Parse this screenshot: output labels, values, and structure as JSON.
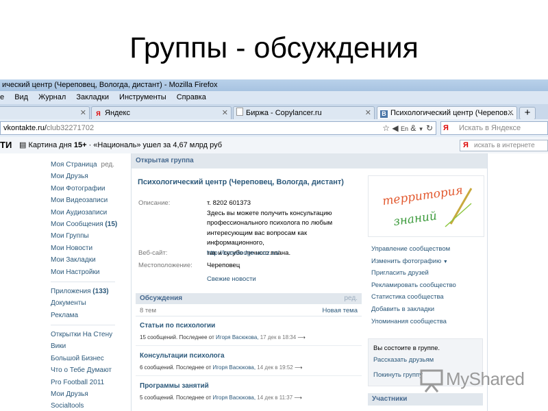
{
  "slide": {
    "title": "Группы - обсуждения"
  },
  "browser": {
    "window_title": "ический центр (Череповец, Вологда, дистант) - Mozilla Firefox",
    "menu": [
      "Вид",
      "Журнал",
      "Закладки",
      "Инструменты",
      "Справка"
    ],
    "menu_first_fragment": "е",
    "tabs": [
      {
        "label": "",
        "icon": "blank-page-icon"
      },
      {
        "label": "Яндекс",
        "icon": "yandex-icon"
      },
      {
        "label": "Биржа - Copylancer.ru",
        "icon": "blank-page-icon"
      },
      {
        "label": "Психологический центр (Черепов...",
        "icon": "vk-icon",
        "active": true
      }
    ],
    "new_tab": "+",
    "url_host": "vkontakte.ru/",
    "url_path": "club32271702",
    "search_placeholder": "Искать в Яндексе",
    "bookmark_logo": "ТИ",
    "news_ticker": "Картина дня 15+ · «Националь» ушел за 4,67 млрд руб",
    "news_day": "Картина дня",
    "news_count": "15+",
    "news_text": "«Националь» ушел за 4,67 млрд руб",
    "yandex_placeholder": "искать в интернете"
  },
  "left_nav": {
    "group1": [
      {
        "label": "Моя Страница",
        "edit": "ред."
      },
      {
        "label": "Мои Друзья"
      },
      {
        "label": "Мои Фотографии"
      },
      {
        "label": "Мои Видеозаписи"
      },
      {
        "label": "Мои Аудиозаписи"
      },
      {
        "label": "Мои Сообщения",
        "count": "(15)"
      },
      {
        "label": "Мои Группы"
      },
      {
        "label": "Мои Новости"
      },
      {
        "label": "Мои Закладки"
      },
      {
        "label": "Мои Настройки"
      }
    ],
    "group2": [
      {
        "label": "Приложения",
        "count": "(133)"
      },
      {
        "label": "Документы"
      },
      {
        "label": "Реклама"
      }
    ],
    "group3": [
      {
        "label": "Открытки На Стену"
      },
      {
        "label": "Вики"
      },
      {
        "label": "Большой Бизнес"
      },
      {
        "label": "Что о Тебе Думают"
      },
      {
        "label": "Pro Football 2011"
      },
      {
        "label": "Мои Друзья"
      },
      {
        "label": "Socialtools"
      }
    ]
  },
  "group": {
    "type": "Открытая группа",
    "name": "Психологический центр (Череповец, Вологда, дистант)",
    "description_label": "Описание:",
    "description_lines": [
      "т. 8202 601373",
      "Здесь вы можете получить консультацию",
      "профессионального психолога по любым",
      "интересующим вас вопросам как информационного,",
      "так и сугубо личного плана."
    ],
    "website_label": "Веб-сайт:",
    "website": "http://knowledge.ucoz.ru/",
    "location_label": "Местоположение:",
    "location": "Череповец",
    "fresh_news": "Свежие новости",
    "logo_text_1": "территория",
    "logo_text_2": "знаний"
  },
  "discussions": {
    "title": "Обсуждения",
    "edit": "ред.",
    "count": "8 тем",
    "new_topic": "Новая тема",
    "topics": [
      {
        "title": "Статьи по психологии",
        "count": "15 сообщений.",
        "last_prefix": "Последнее от",
        "author": "Игоря Васюкова,",
        "date": "17 дек в 18:34"
      },
      {
        "title": "Консультации психолога",
        "count": "6 сообщений.",
        "last_prefix": "Последнее от",
        "author": "Игоря Васюкова,",
        "date": "14 дек в 19:52"
      },
      {
        "title": "Программы занятий",
        "count": "5 сообщений.",
        "last_prefix": "Последнее от",
        "author": "Игоря Васюкова,",
        "date": "14 дек в 11:37"
      }
    ]
  },
  "actions": [
    {
      "label": "Управление сообществом"
    },
    {
      "label": "Изменить фотографию",
      "arrow": "▼"
    },
    {
      "label": "Пригласить друзей"
    },
    {
      "label": "Рекламировать сообщество"
    },
    {
      "label": "Статистика сообщества"
    },
    {
      "label": "Добавить в закладки"
    },
    {
      "label": "Упоминания сообщества"
    }
  ],
  "membership": {
    "question": "Вы состоите в группе.",
    "tell_friends": "Рассказать друзьям",
    "leave": "Покинуть группу"
  },
  "members": {
    "title": "Участники",
    "count": ""
  },
  "watermark": {
    "text": "MyShared"
  },
  "colors": {
    "vk_link": "#2b587a",
    "vk_header": "#45688e",
    "header_bg": "#e1e7ed"
  }
}
